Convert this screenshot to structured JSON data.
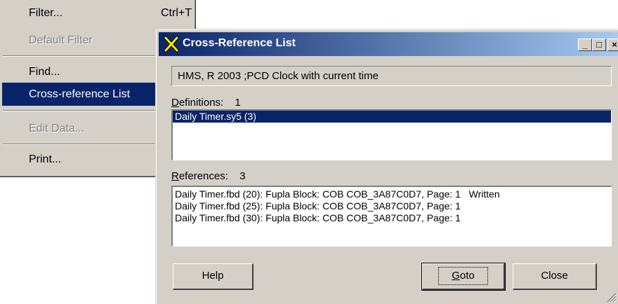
{
  "menu": {
    "items": [
      {
        "label": "Filter...",
        "shortcut": "Ctrl+T"
      },
      {
        "label": "Default Filter"
      },
      {
        "label": "Find..."
      },
      {
        "label": "Cross-reference List"
      },
      {
        "label": "Edit Data..."
      },
      {
        "label": "Print..."
      }
    ]
  },
  "dialog": {
    "title": "Cross-Reference List",
    "controls": {
      "minimize": "_",
      "maximize": "□",
      "close": "×"
    },
    "symbol_description": "HMS, R 2003 ;PCD Clock with current time",
    "definitions": {
      "label_u": "D",
      "label_rest": "efinitions:",
      "count": "1",
      "items": [
        "Daily Timer.sy5 (3)"
      ]
    },
    "references": {
      "label_u": "R",
      "label_rest": "eferences:",
      "count": "3",
      "items": [
        "Daily Timer.fbd (20): Fupla Block: COB COB_3A87C0D7, Page: 1   Written",
        "Daily Timer.fbd (25): Fupla Block: COB COB_3A87C0D7, Page: 1",
        "Daily Timer.fbd (30): Fupla Block: COB COB_3A87C0D7, Page: 1"
      ]
    },
    "buttons": {
      "help": "Help",
      "goto_u": "G",
      "goto_rest": "oto",
      "close": "Close"
    }
  },
  "colors": {
    "selection": "#0a246a",
    "face": "#d4d0c8",
    "title_end": "#a6caf0"
  }
}
